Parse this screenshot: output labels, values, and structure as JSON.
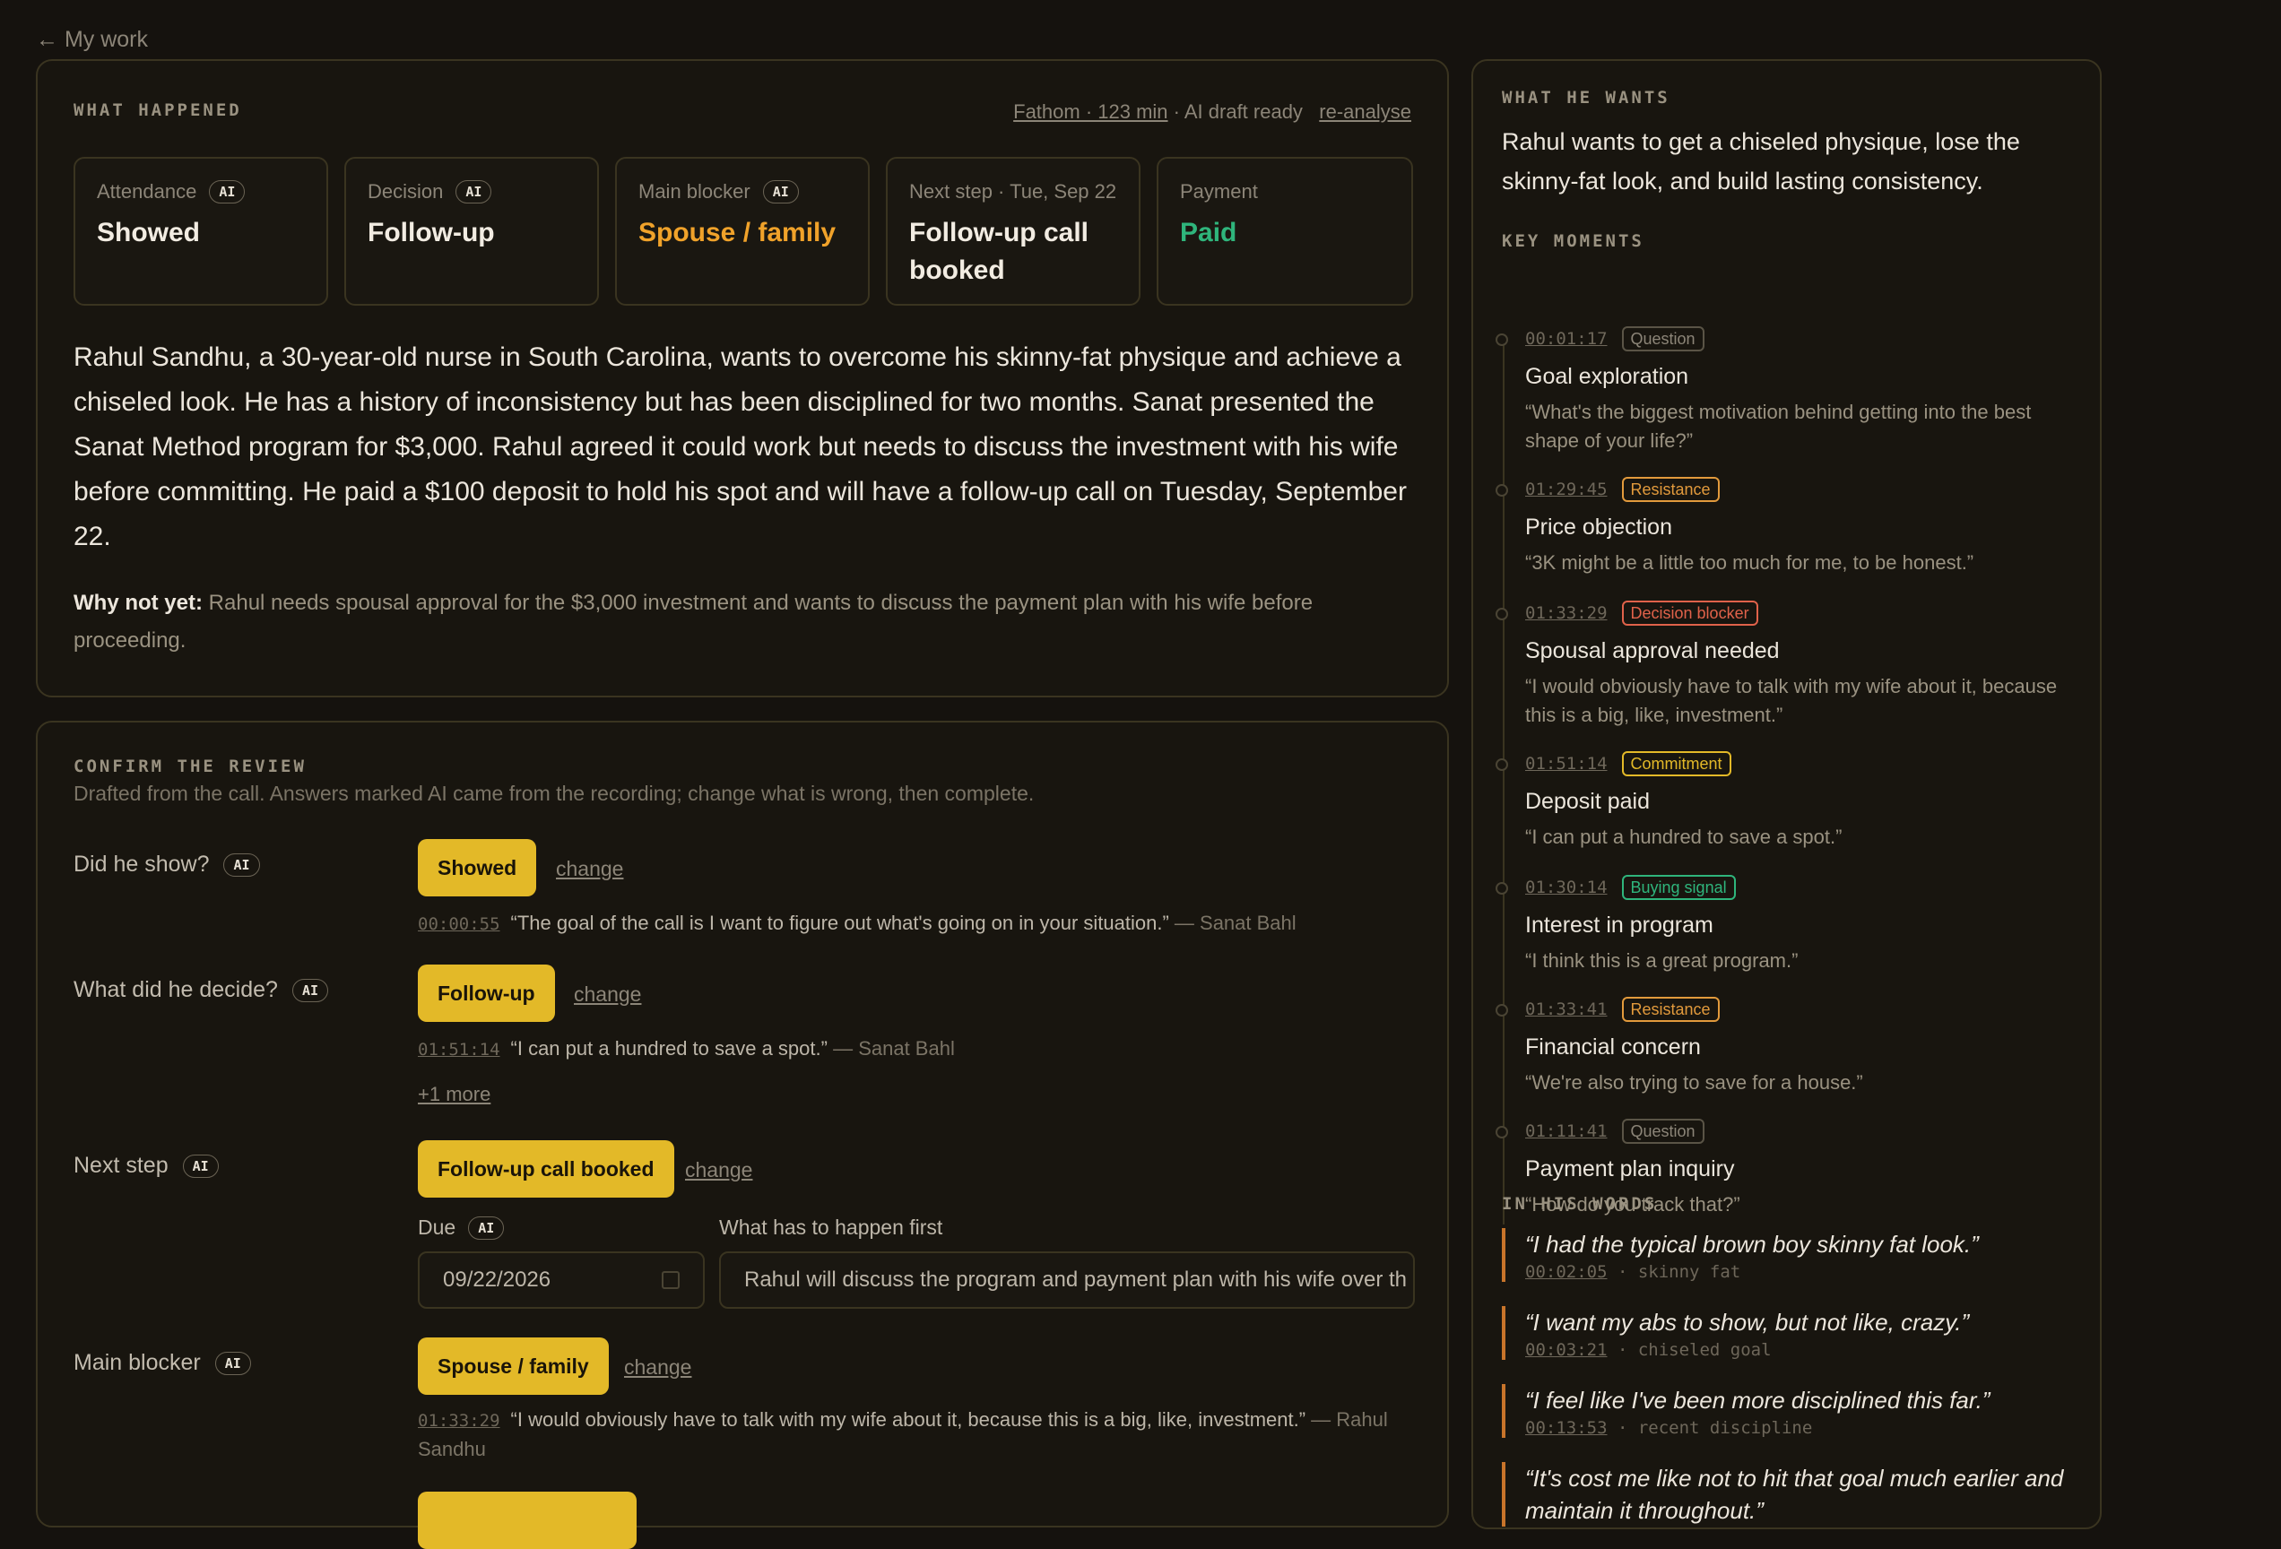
{
  "nav": {
    "back": "← My work"
  },
  "happened": {
    "section_label": "WHAT HAPPENED",
    "meta": {
      "source": "Fathom · 123 min",
      "status": " · AI draft ready",
      "reanalyse": "re-analyse"
    },
    "stats": [
      {
        "label": "Attendance",
        "ai": "AI",
        "value": "Showed",
        "color": "#f2ece2"
      },
      {
        "label": "Decision",
        "ai": "AI",
        "value": "Follow-up",
        "color": "#f2ece2"
      },
      {
        "label": "Main blocker",
        "ai": "AI",
        "value": "Spouse / family",
        "color": "#f0a22a"
      },
      {
        "label": "Next step · Tue, Sep 22",
        "ai": "",
        "value": "Follow-up call booked",
        "color": "#f2ece2"
      },
      {
        "label": "Payment",
        "ai": "",
        "value": "Paid",
        "color": "#2fb57c"
      }
    ],
    "summary": "Rahul Sandhu, a 30-year-old nurse in South Carolina, wants to overcome his skinny-fat physique and achieve a chiseled look. He has a history of inconsistency but has been disciplined for two months. Sanat presented the Sanat Method program for $3,000. Rahul agreed it could work but needs to discuss the investment with his wife before committing. He paid a $100 deposit to hold his spot and will have a follow-up call on Tuesday, September 22.",
    "why_not_label": "Why not yet:",
    "why_not": " Rahul needs spousal approval for the $3,000 investment and wants to discuss the payment plan with his wife before proceeding."
  },
  "confirm": {
    "section_label": "CONFIRM THE REVIEW",
    "subtitle": "Drafted from the call. Answers marked AI came from the recording; change what is wrong, then complete.",
    "change": "change",
    "ai": "AI",
    "q1": {
      "label": "Did he show?",
      "answer": "Showed",
      "ts": "00:00:55",
      "quote": "“The goal of the call is I want to figure out what's going on in your situation.”",
      "who": " — Sanat Bahl"
    },
    "q2": {
      "label": "What did he decide?",
      "answer": "Follow-up",
      "ts": "01:51:14",
      "quote": "“I can put a hundred to save a spot.”",
      "who": " — Sanat Bahl",
      "more": "+1 more"
    },
    "q3": {
      "label": "Next step",
      "answer": "Follow-up call booked",
      "due_label": "Due",
      "due_value": "09/22/2026",
      "first_label": "What has to happen first",
      "first_value": "Rahul will discuss the program and payment plan with his wife over th"
    },
    "q4": {
      "label": "Main blocker",
      "answer": "Spouse / family",
      "ts": "01:33:29",
      "quote": "“I would obviously have to talk with my wife about it, because this is a big, like, investment.”",
      "who": " — Rahul Sandhu"
    }
  },
  "wants": {
    "section_label": "WHAT HE WANTS",
    "text": "Rahul wants to get a chiseled physique, lose the skinny-fat look, and build lasting consistency.",
    "moments_label": "KEY MOMENTS",
    "moments": [
      {
        "ts": "00:01:17",
        "tag": "Question",
        "tag_color": "#8c8578",
        "title": "Goal exploration",
        "quote": "“What's the biggest motivation behind getting into the best shape of your life?”"
      },
      {
        "ts": "01:29:45",
        "tag": "Resistance",
        "tag_color": "#e29a3c",
        "title": "Price objection",
        "quote": "“3K might be a little too much for me, to be honest.”"
      },
      {
        "ts": "01:33:29",
        "tag": "Decision blocker",
        "tag_color": "#e0624a",
        "title": "Spousal approval needed",
        "quote": "“I would obviously have to talk with my wife about it, because this is a big, like, investment.”"
      },
      {
        "ts": "01:51:14",
        "tag": "Commitment",
        "tag_color": "#e3b928",
        "title": "Deposit paid",
        "quote": "“I can put a hundred to save a spot.”"
      },
      {
        "ts": "01:30:14",
        "tag": "Buying signal",
        "tag_color": "#2fb57c",
        "title": "Interest in program",
        "quote": "“I think this is a great program.”"
      },
      {
        "ts": "01:33:41",
        "tag": "Resistance",
        "tag_color": "#e29a3c",
        "title": "Financial concern",
        "quote": "“We're also trying to save for a house.”"
      },
      {
        "ts": "01:11:41",
        "tag": "Question",
        "tag_color": "#8c8578",
        "title": "Payment plan inquiry",
        "quote": "“How do you track that?”"
      }
    ],
    "words_label": "IN HIS WORDS",
    "words": [
      {
        "quote": "“I had the typical brown boy skinny fat look.”",
        "ts": "00:02:05",
        "topic": " · skinny fat"
      },
      {
        "quote": "“I want my abs to show, but not like, crazy.”",
        "ts": "00:03:21",
        "topic": " · chiseled goal"
      },
      {
        "quote": "“I feel like I've been more disciplined this far.”",
        "ts": "00:13:53",
        "topic": " · recent discipline"
      },
      {
        "quote": "“It's cost me like not to hit that goal much earlier and maintain it throughout.”",
        "ts": "",
        "topic": ""
      }
    ]
  }
}
